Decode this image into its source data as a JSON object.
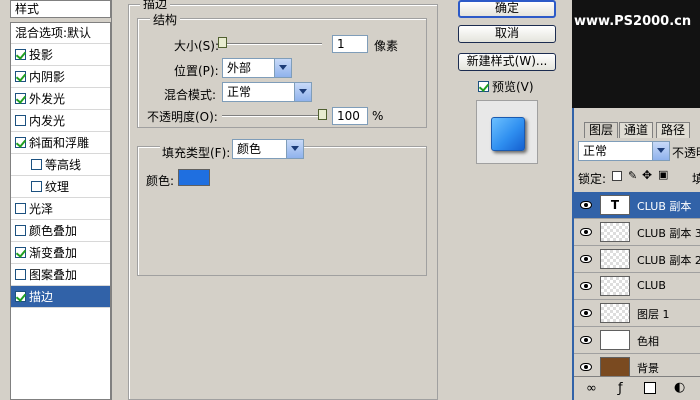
{
  "styles_panel": {
    "header": "样式",
    "items": [
      {
        "label": "混合选项:默认",
        "checkbox": false,
        "checked": false,
        "selected": false,
        "sub": false
      },
      {
        "label": "投影",
        "checkbox": true,
        "checked": true,
        "selected": false,
        "sub": false
      },
      {
        "label": "内阴影",
        "checkbox": true,
        "checked": true,
        "selected": false,
        "sub": false
      },
      {
        "label": "外发光",
        "checkbox": true,
        "checked": true,
        "selected": false,
        "sub": false
      },
      {
        "label": "内发光",
        "checkbox": true,
        "checked": false,
        "selected": false,
        "sub": false
      },
      {
        "label": "斜面和浮雕",
        "checkbox": true,
        "checked": true,
        "selected": false,
        "sub": false
      },
      {
        "label": "等高线",
        "checkbox": true,
        "checked": false,
        "selected": false,
        "sub": true
      },
      {
        "label": "纹理",
        "checkbox": true,
        "checked": false,
        "selected": false,
        "sub": true
      },
      {
        "label": "光泽",
        "checkbox": true,
        "checked": false,
        "selected": false,
        "sub": false
      },
      {
        "label": "颜色叠加",
        "checkbox": true,
        "checked": false,
        "selected": false,
        "sub": false
      },
      {
        "label": "渐变叠加",
        "checkbox": true,
        "checked": true,
        "selected": false,
        "sub": false
      },
      {
        "label": "图案叠加",
        "checkbox": true,
        "checked": false,
        "selected": false,
        "sub": false
      },
      {
        "label": "描边",
        "checkbox": true,
        "checked": true,
        "selected": true,
        "sub": false
      }
    ]
  },
  "stroke": {
    "group_title": "描边",
    "structure_title": "结构",
    "size_label": "大小(S):",
    "size_value": "1",
    "size_unit": "像素",
    "size_slider_fraction": 0.0,
    "position_label": "位置(P):",
    "position_value": "外部",
    "blend_label": "混合模式:",
    "blend_value": "正常",
    "opacity_label": "不透明度(O):",
    "opacity_value": "100",
    "opacity_unit": "%",
    "opacity_slider_fraction": 1.0,
    "fill_type_label": "填充类型(F):",
    "fill_type_value": "颜色",
    "color_label": "颜色:",
    "color_swatch": "#1f6fe0"
  },
  "buttons": {
    "ok": "确定",
    "cancel": "取消",
    "new_style": "新建样式(W)...",
    "preview": "预览(V)",
    "preview_checked": true
  },
  "preview_swatch_color": "#2f8ff0",
  "watermark": "www.PS2000.cn",
  "layers_panel": {
    "tabs": [
      "图层",
      "通道",
      "路径"
    ],
    "blend_mode": "正常",
    "opacity_label": "不透明",
    "lock_label": "锁定:",
    "lock_trailing": "填",
    "layers": [
      {
        "name": "CLUB 副本",
        "type": "text",
        "selected": true
      },
      {
        "name": "CLUB 副本 3",
        "type": "pixel",
        "selected": false
      },
      {
        "name": "CLUB 副本 2",
        "type": "pixel",
        "selected": false
      },
      {
        "name": "CLUB",
        "type": "pixel",
        "selected": false
      },
      {
        "name": "图层 1",
        "type": "pixel",
        "selected": false
      },
      {
        "name": "色相",
        "type": "adjustment",
        "selected": false
      },
      {
        "name": "背景",
        "type": "background",
        "selected": false
      }
    ]
  }
}
